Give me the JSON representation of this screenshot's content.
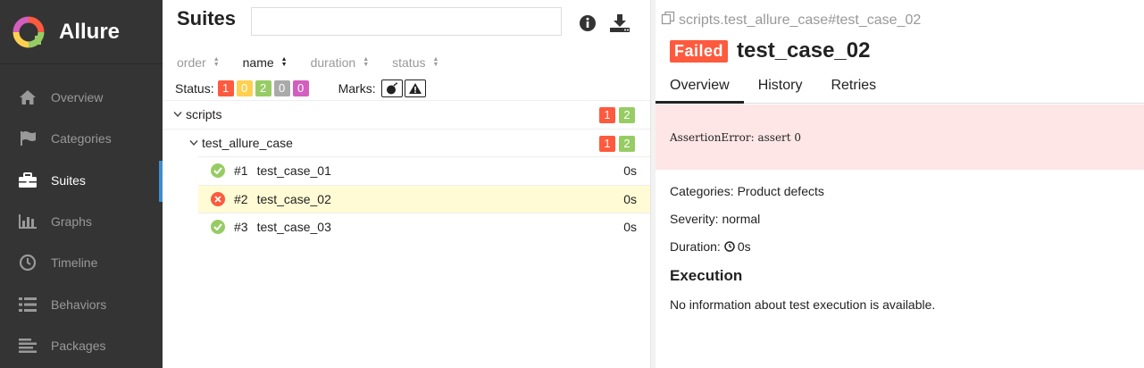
{
  "app": {
    "name": "Allure"
  },
  "sidebar": {
    "items": [
      {
        "label": "Overview",
        "icon": "home-icon"
      },
      {
        "label": "Categories",
        "icon": "flag-icon"
      },
      {
        "label": "Suites",
        "icon": "briefcase-icon"
      },
      {
        "label": "Graphs",
        "icon": "bar-chart-icon"
      },
      {
        "label": "Timeline",
        "icon": "clock-icon"
      },
      {
        "label": "Behaviors",
        "icon": "list-icon"
      },
      {
        "label": "Packages",
        "icon": "align-left-icon"
      }
    ],
    "active": "Suites"
  },
  "suites": {
    "title": "Suites",
    "search_placeholder": "",
    "sort": [
      {
        "label": "order"
      },
      {
        "label": "name"
      },
      {
        "label": "duration"
      },
      {
        "label": "status"
      }
    ],
    "status_label": "Status:",
    "status_counts": {
      "failed": "1",
      "broken": "0",
      "passed": "2",
      "skipped": "0",
      "unknown": "0"
    },
    "marks_label": "Marks:",
    "tree": {
      "group": {
        "name": "scripts",
        "failed": "1",
        "passed": "2"
      },
      "subgroup": {
        "name": "test_allure_case",
        "failed": "1",
        "passed": "2"
      },
      "tests": [
        {
          "num": "#1",
          "name": "test_case_01",
          "duration": "0s",
          "status": "passed"
        },
        {
          "num": "#2",
          "name": "test_case_02",
          "duration": "0s",
          "status": "failed"
        },
        {
          "num": "#3",
          "name": "test_case_03",
          "duration": "0s",
          "status": "passed"
        }
      ]
    }
  },
  "detail": {
    "breadcrumb": "scripts.test_allure_case#test_case_02",
    "status_badge": "Failed",
    "title": "test_case_02",
    "tabs": [
      "Overview",
      "History",
      "Retries"
    ],
    "error": "AssertionError: assert 0",
    "categories_label": "Categories:",
    "categories_value": "Product defects",
    "severity_label": "Severity:",
    "severity_value": "normal",
    "duration_label": "Duration:",
    "duration_value": "0s",
    "execution_title": "Execution",
    "execution_text": "No information about test execution is available."
  },
  "colors": {
    "failed": "#fd5a3e",
    "broken": "#ffd050",
    "passed": "#97cc64",
    "skipped": "#aaaaaa",
    "unknown": "#d35ebe",
    "sidebar_bg": "#343434",
    "selected_row": "#fffbd5",
    "error_bg": "#fee6e6"
  }
}
